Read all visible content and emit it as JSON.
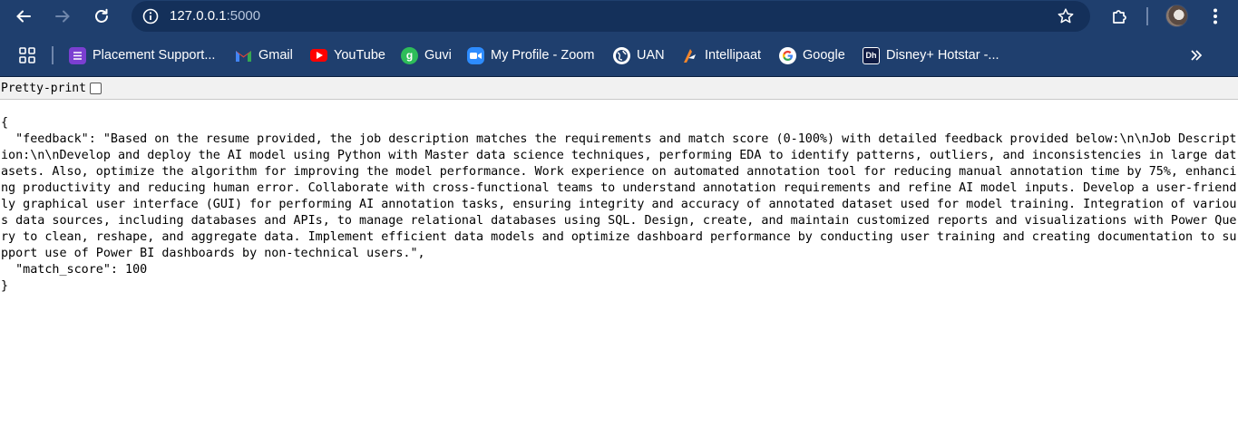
{
  "browser": {
    "url_host": "127.0.0.1",
    "url_port": ":5000"
  },
  "bookmarks": [
    {
      "label": "Placement Support...",
      "icon": "list-icon",
      "color": "#7b3fd1"
    },
    {
      "label": "Gmail",
      "icon": "gmail-icon",
      "color": "#ea4335"
    },
    {
      "label": "YouTube",
      "icon": "youtube-icon",
      "color": "#ff0000"
    },
    {
      "label": "Guvi",
      "icon": "guvi-icon",
      "color": "#2ebd59"
    },
    {
      "label": "My Profile - Zoom",
      "icon": "zoom-icon",
      "color": "#2d8cff"
    },
    {
      "label": "UAN",
      "icon": "globe-icon",
      "color": "#ffffff"
    },
    {
      "label": "Intellipaat",
      "icon": "intellipaat-icon",
      "color": "#f5862b"
    },
    {
      "label": "Google",
      "icon": "google-icon",
      "color": "#4285f4"
    },
    {
      "label": "Disney+ Hotstar -...",
      "icon": "hotstar-icon",
      "color": "#0f1b44"
    }
  ],
  "pretty_print": {
    "label": "Pretty-print",
    "checked": false
  },
  "json_body": {
    "open_brace": "{",
    "feedback_line": "  \"feedback\": \"Based on the resume provided, the job description matches the requirements and match score (0-100%) with detailed feedback provided below:\\n\\nJob Description:\\n\\nDevelop and deploy the AI model using Python with Master data science techniques, performing EDA to identify patterns, outliers, and inconsistencies in large datasets. Also, optimize the algorithm for improving the model performance. Work experience on automated annotation tool for reducing manual annotation time by 75%, enhancing productivity and reducing human error. Collaborate with cross-functional teams to understand annotation requirements and refine AI model inputs. Develop a user-friendly graphical user interface (GUI) for performing AI annotation tasks, ensuring integrity and accuracy of annotated dataset used for model training. Integration of various data sources, including databases and APIs, to manage relational databases using SQL. Design, create, and maintain customized reports and visualizations with Power Query to clean, reshape, and aggregate data. Implement efficient data models and optimize dashboard performance by conducting user training and creating documentation to support use of Power BI dashboards by non-technical users.\",",
    "match_score_line": "  \"match_score\": 100",
    "close_brace": "}"
  }
}
